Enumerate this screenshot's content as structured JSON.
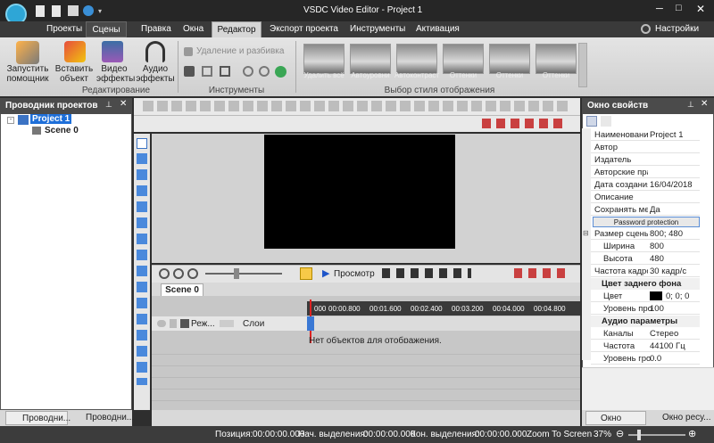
{
  "app": {
    "title": "VSDC Video Editor - Project 1",
    "settings": "Настройки"
  },
  "tabs": [
    {
      "label": "Проекты"
    },
    {
      "label": "Сцены"
    },
    {
      "label": "Правка"
    },
    {
      "label": "Окна"
    },
    {
      "label": "Редактор"
    },
    {
      "label": "Экспорт проекта"
    },
    {
      "label": "Инструменты"
    },
    {
      "label": "Активация"
    }
  ],
  "ribbon": {
    "run_wizard": "Запустить помощник",
    "insert_object": "Вставить объект",
    "video_effects": "Видео эффекты",
    "audio_effects": "Аудио эффекты",
    "group_editing": "Редактирование",
    "delete_split": "Удаление и разбивка",
    "group_tools": "Инструменты",
    "styles": [
      "Удалить всё",
      "Автоуровни",
      "Автоконтраст",
      "Оттенки",
      "Оттенки",
      "Оттенки"
    ],
    "group_style": "Выбор стиля отображения"
  },
  "explorer": {
    "title": "Проводник проектов",
    "project": "Project 1",
    "scene": "Scene 0",
    "tab1": "Проводни...",
    "tab2": "Проводни..."
  },
  "preview": {
    "label": "Просмотр"
  },
  "timeline": {
    "tab": "Scene 0",
    "mode": "Реж...",
    "layers": "Слои",
    "empty": "Нет объектов для отображения.",
    "ticks": [
      "000",
      "00:00.800",
      "00:01.600",
      "00:02.400",
      "00:03.200",
      "00:04.000",
      "00:04.800"
    ]
  },
  "props": {
    "title": "Окно свойств",
    "rows": [
      {
        "k": "Наименование",
        "v": "Project 1"
      },
      {
        "k": "Автор",
        "v": ""
      },
      {
        "k": "Издатель",
        "v": ""
      },
      {
        "k": "Авторские пра",
        "v": ""
      },
      {
        "k": "Дата создания",
        "v": "16/04/2018"
      },
      {
        "k": "Описание",
        "v": ""
      },
      {
        "k": "Сохранять мет",
        "v": "Да"
      }
    ],
    "password": "Password protection",
    "size_label": "Размер сцены",
    "size_val": "800; 480",
    "w_label": "Ширина",
    "w_val": "800",
    "h_label": "Высота",
    "h_val": "480",
    "fps_label": "Частота кадров",
    "fps_val": "30 кадр/с",
    "bg_section": "Цвет заднего фона",
    "color_label": "Цвет",
    "color_val": "0; 0; 0",
    "level_label": "Уровень про",
    "level_val": "100",
    "audio_section": "Аудио параметры",
    "ch_label": "Каналы",
    "ch_val": "Стерео",
    "freq_label": "Частота",
    "freq_val": "44100 Гц",
    "vol_label": "Уровень гро",
    "vol_val": "0.0",
    "tab1": "Окно сво...",
    "tab2": "Окно ресу..."
  },
  "status": {
    "pos_label": "Позиция:",
    "pos_val": "00:00:00.000",
    "start_label": "Нач. выделения:",
    "start_val": "00:00:00.000",
    "end_label": "Кон. выделения:",
    "end_val": "00:00:00.000",
    "zoom_btn": "Zoom To Screen",
    "zoom_val": "37%"
  }
}
